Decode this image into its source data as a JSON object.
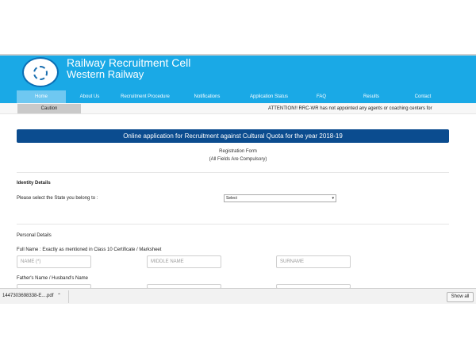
{
  "header": {
    "title": "Railway Recruitment Cell",
    "subtitle": "Western Railway",
    "bg_color": "#1aa9e6"
  },
  "nav": {
    "items": [
      {
        "label": "Home",
        "active": true
      },
      {
        "label": "About Us",
        "active": false
      },
      {
        "label": "Recruitment Procedure",
        "active": false
      },
      {
        "label": "Notifications",
        "active": false
      },
      {
        "label": "Application Status",
        "active": false
      },
      {
        "label": "FAQ",
        "active": false
      },
      {
        "label": "Results",
        "active": false
      },
      {
        "label": "Contact",
        "active": false
      }
    ]
  },
  "caution": {
    "label": "Caution",
    "marquee": "ATTENTION!! RRC-WR has not appointed any agents or coaching centers for"
  },
  "form": {
    "banner": "Online application for Recruitment against Cultural Quota for the year 2018-19",
    "reg_title": "Registration Form",
    "reg_note": "(All Fields Are Compulsory)",
    "identity": {
      "heading": "Identity Details",
      "state_label": "Please select the State you belong to :",
      "state_value": "Select"
    },
    "personal": {
      "heading": "Personal Details",
      "fullname_label": "Full Name : Exactly as mentioned in Class 10 Certificate / Marksheet",
      "name_placeholder": "NAME (*)",
      "middle_placeholder": "MIDDLE NAME",
      "surname_placeholder": "SURNAME",
      "father_label": "Father's Name / Husband's Name"
    }
  },
  "download_bar": {
    "file_name": "1447303698338-E....pdf",
    "show_all": "Show all"
  }
}
